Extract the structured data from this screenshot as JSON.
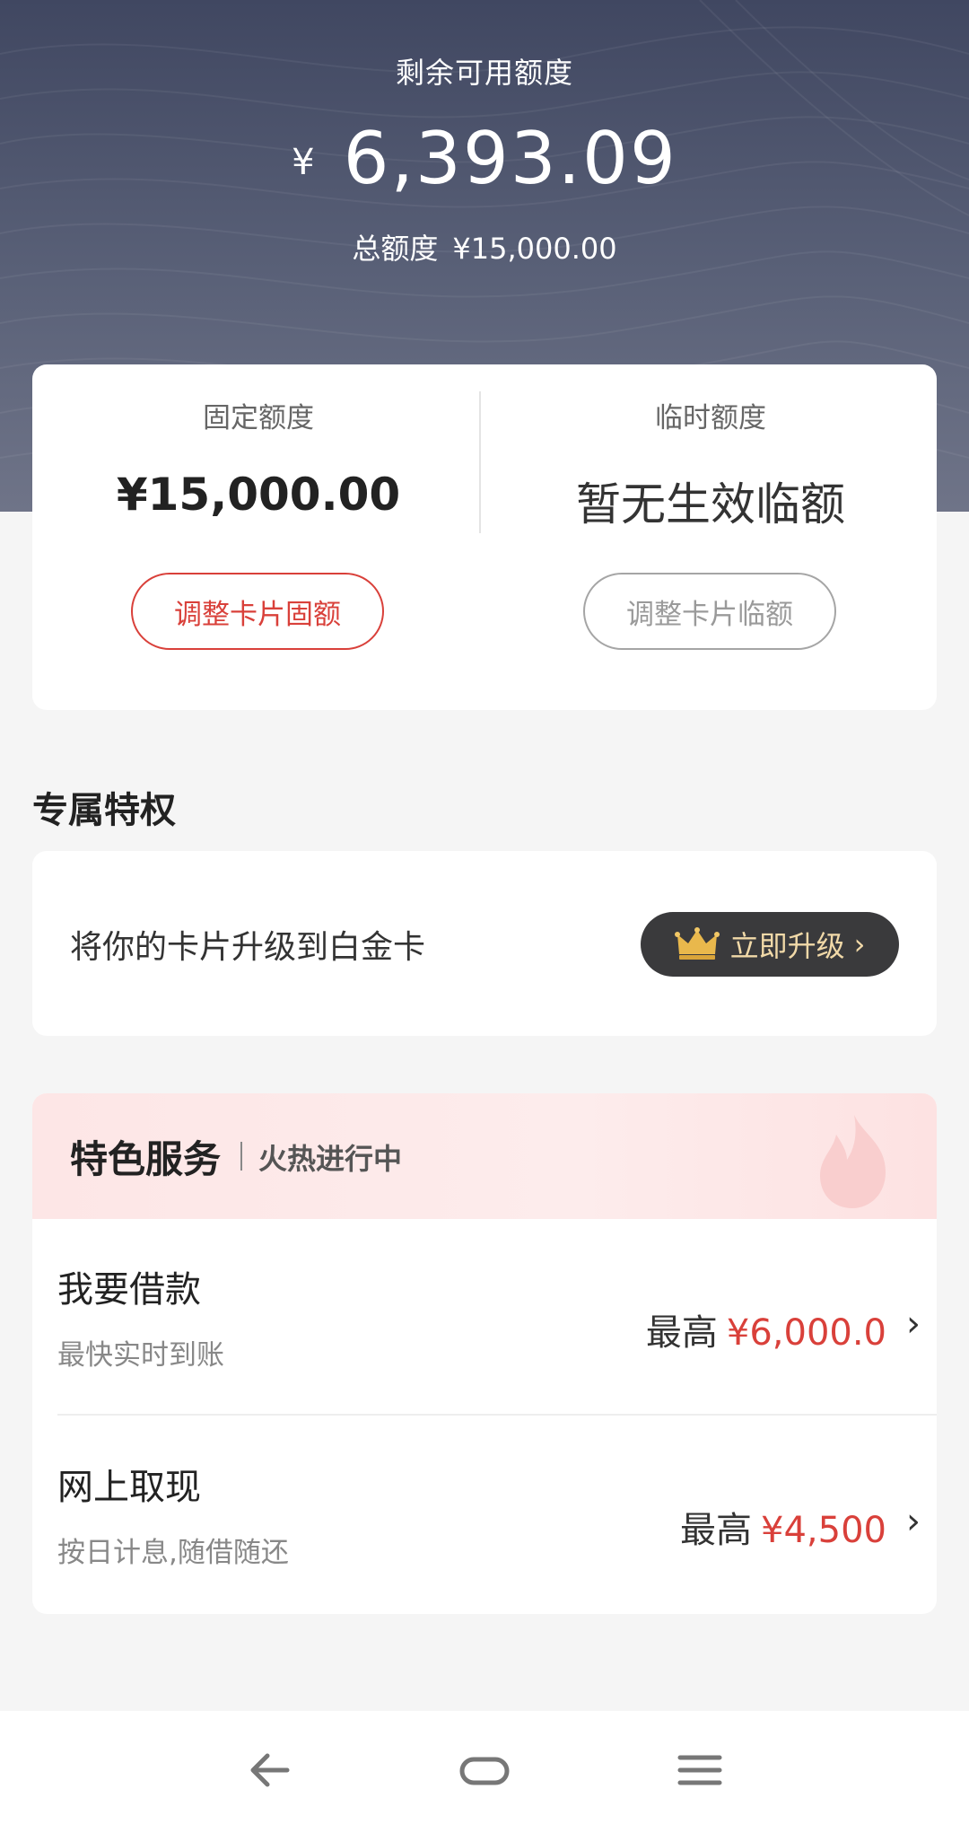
{
  "header": {
    "available_label": "剩余可用额度",
    "currency_symbol": "¥",
    "available_amount": "6,393.09",
    "total_label": "总额度",
    "total_amount": "¥15,000.00"
  },
  "limits": {
    "fixed": {
      "title": "固定额度",
      "value": "¥15,000.00",
      "button_label": "调整卡片固额"
    },
    "temporary": {
      "title": "临时额度",
      "value": "暂无生效临额",
      "button_label": "调整卡片临额"
    }
  },
  "privilege": {
    "section_title": "专属特权",
    "upgrade_text": "将你的卡片升级到白金卡",
    "upgrade_button": "立即升级",
    "upgrade_chevron": "›"
  },
  "services": {
    "title": "特色服务",
    "subtitle": "火热进行中",
    "items": [
      {
        "name": "我要借款",
        "desc": "最快实时到账",
        "prefix": "最高",
        "amount": "¥6,000.0",
        "chevron": "›"
      },
      {
        "name": "网上取现",
        "desc": "按日计息,随借随还",
        "prefix": "最高",
        "amount": "¥4,500",
        "chevron": "›"
      }
    ]
  },
  "colors": {
    "accent_red": "#d9403a",
    "header_bg": "#4a5068",
    "gold": "#e9b84c"
  },
  "icons": [
    "crown-icon",
    "flame-icon",
    "back-icon",
    "home-icon",
    "menu-icon"
  ]
}
